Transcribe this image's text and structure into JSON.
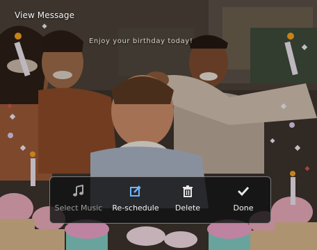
{
  "window": {
    "title": "View Message"
  },
  "banner": {
    "text": "Enjoy your birthday today!"
  },
  "menu": {
    "items": [
      {
        "label": "Select Music",
        "icon": "music-note-icon",
        "enabled": false
      },
      {
        "label": "Re-schedule",
        "icon": "edit-icon",
        "enabled": true,
        "accent": "#6fb6ff"
      },
      {
        "label": "Delete",
        "icon": "trash-icon",
        "enabled": true
      },
      {
        "label": "Done",
        "icon": "checkmark-icon",
        "enabled": true
      }
    ]
  },
  "colors": {
    "accent": "#6fb6ff",
    "menu_bg": "#121214",
    "text": "#f4f4f4",
    "disabled_text": "#9c9c9c"
  }
}
